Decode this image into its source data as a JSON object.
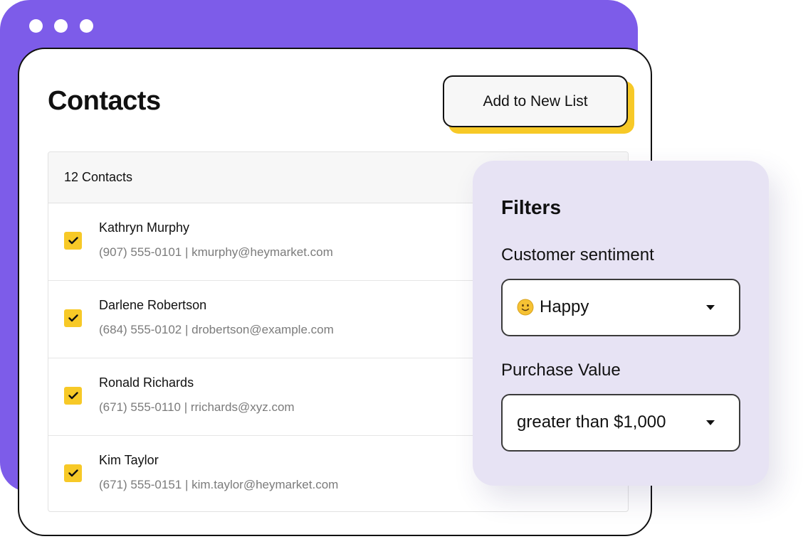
{
  "window": {
    "dots": [
      "window-dot-1",
      "window-dot-2",
      "window-dot-3"
    ]
  },
  "main": {
    "title": "Contacts",
    "add_button_label": "Add to New List",
    "list_header": "12 Contacts",
    "contacts": [
      {
        "name": "Kathryn Murphy",
        "detail": "(907) 555-0101 | kmurphy@heymarket.com",
        "checked": true
      },
      {
        "name": "Darlene Robertson",
        "detail": "(684) 555-0102 | drobertson@example.com",
        "checked": true
      },
      {
        "name": "Ronald Richards",
        "detail": "(671) 555-0110 | rrichards@xyz.com",
        "checked": true
      },
      {
        "name": "Kim Taylor",
        "detail": "(671) 555-0151 | kim.taylor@heymarket.com",
        "checked": true
      }
    ]
  },
  "filters": {
    "title": "Filters",
    "sentiment_label": "Customer sentiment",
    "sentiment_value": "Happy",
    "sentiment_icon": "slightly-smiling-face-icon",
    "purchase_label": "Purchase Value",
    "purchase_value": "greater than $1,000"
  },
  "colors": {
    "brand_purple": "#7d5ce9",
    "accent_yellow": "#f7c927",
    "filters_bg": "#e7e3f4"
  }
}
